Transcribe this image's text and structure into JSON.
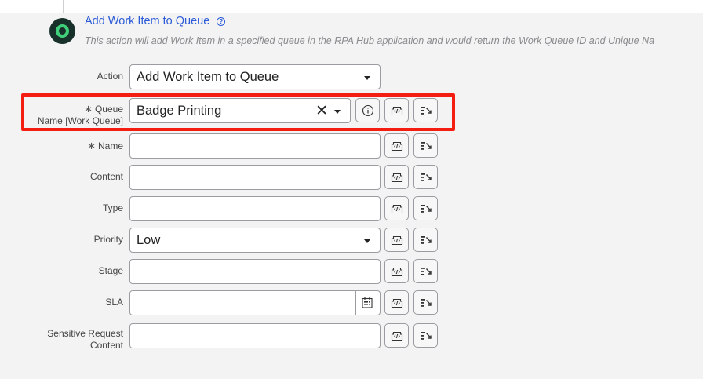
{
  "header": {
    "title": "Add Work Item to Queue",
    "help_glyph": "?",
    "description": "This action will add Work Item in a specified queue in the RPA Hub application and would return the Work Queue ID and Unique Na"
  },
  "fields": {
    "action": {
      "label": "Action",
      "value": "Add Work Item to Queue"
    },
    "queue": {
      "required_mark": "∗",
      "label_line1": "Queue",
      "label_line2": "Name [Work Queue]",
      "value": "Badge Printing",
      "clear_glyph": "✕"
    },
    "name": {
      "required_mark": "∗",
      "label": "Name",
      "value": ""
    },
    "content": {
      "label": "Content",
      "value": ""
    },
    "type": {
      "label": "Type",
      "value": ""
    },
    "priority": {
      "label": "Priority",
      "value": "Low"
    },
    "stage": {
      "label": "Stage",
      "value": ""
    },
    "sla": {
      "label": "SLA",
      "value": ""
    },
    "sensitive": {
      "label_line1": "Sensitive Request",
      "label_line2": "Content",
      "value": ""
    }
  },
  "colors": {
    "accent_link": "#2b5bd7",
    "highlight_border": "#f31d12",
    "icon_badge": "#3fcf7a"
  },
  "icons": {
    "info": "info-icon",
    "variable": "variable-icon",
    "expression": "expression-builder-icon",
    "calendar": "calendar-icon"
  }
}
